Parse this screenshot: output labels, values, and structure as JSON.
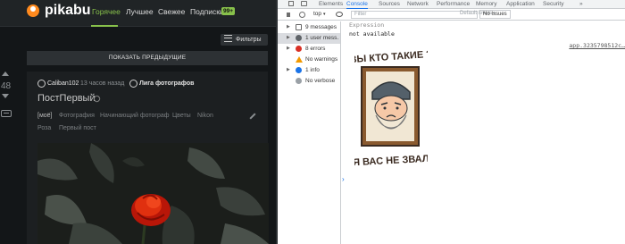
{
  "pikabu": {
    "logo": "pikabu",
    "nav": [
      "Горячее",
      "Лучшее",
      "Свежее",
      "Подписки"
    ],
    "subs_badge": "99+",
    "filters_label": "Фильтры",
    "show_previous": "ПОКАЗАТЬ ПРЕДЫДУЩИЕ",
    "rating": "48",
    "post": {
      "author": "Caliban102",
      "time": "13 часов назад",
      "community": "Лига фотографов",
      "title": "ПостПервый",
      "tags": [
        "[моё]",
        "Фотография",
        "Начинающий фотограф",
        "Цветы",
        "Nikon",
        "Роза",
        "Первый пост"
      ]
    }
  },
  "devtools": {
    "tabs": [
      "Elements",
      "Console",
      "Sources",
      "Network",
      "Performance",
      "Memory",
      "Application",
      "Security"
    ],
    "active_tab": "Console",
    "context": "top",
    "filter_placeholder": "Filter",
    "levels": "Default levels",
    "no_issues": "No Issues",
    "sidebar": [
      {
        "label": "9 messages",
        "icon": "messages-icon"
      },
      {
        "label": "1 user mess…",
        "icon": "user-icon"
      },
      {
        "label": "8 errors",
        "icon": "error-icon"
      },
      {
        "label": "No warnings",
        "icon": "warning-icon"
      },
      {
        "label": "1 info",
        "icon": "info-icon"
      },
      {
        "label": "No verbose",
        "icon": "verbose-icon"
      }
    ],
    "expression_label": "Expression",
    "expression_value": "not available",
    "source_link": "app.3235798512c…",
    "sticker_top": "ВЫ КТО ТАКИЕ ?",
    "sticker_bottom": "Я ВАС НЕ ЗВАЛ"
  },
  "colors": {
    "pikabu_green": "#88c14b",
    "devtools_accent": "#1a73e8"
  }
}
